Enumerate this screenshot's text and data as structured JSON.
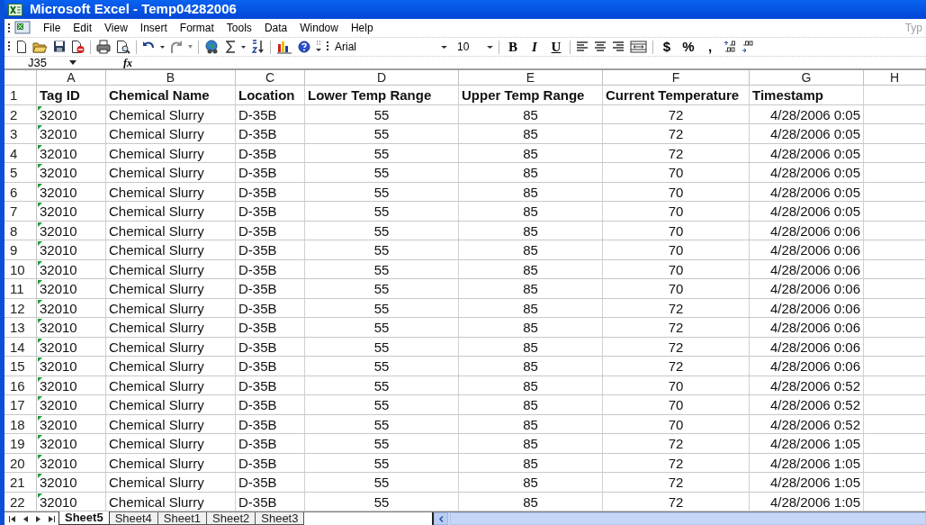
{
  "window": {
    "title": "Microsoft Excel - Temp04282006"
  },
  "menu": [
    "File",
    "Edit",
    "View",
    "Insert",
    "Format",
    "Tools",
    "Data",
    "Window",
    "Help"
  ],
  "help_box": {
    "placeholder": "Typ"
  },
  "toolbar": {
    "font": "Arial",
    "size": "10",
    "format_buttons": [
      "B",
      "I",
      "U"
    ],
    "number_buttons": [
      "$",
      "%",
      ","
    ]
  },
  "formula_bar": {
    "name_box": "J35",
    "fx": "fx"
  },
  "columns": [
    "A",
    "B",
    "C",
    "D",
    "E",
    "F",
    "G",
    "H"
  ],
  "header_row": {
    "number": "1",
    "cells": [
      "Tag ID",
      "Chemical Name",
      "Location",
      "Lower Temp Range",
      "Upper Temp Range",
      "Current Temperature",
      "Timestamp"
    ]
  },
  "rows": [
    {
      "number": "2",
      "cells": [
        "32010",
        "Chemical Slurry",
        "D-35B",
        "55",
        "85",
        "72",
        "4/28/2006 0:05"
      ]
    },
    {
      "number": "3",
      "cells": [
        "32010",
        "Chemical Slurry",
        "D-35B",
        "55",
        "85",
        "72",
        "4/28/2006 0:05"
      ]
    },
    {
      "number": "4",
      "cells": [
        "32010",
        "Chemical Slurry",
        "D-35B",
        "55",
        "85",
        "72",
        "4/28/2006 0:05"
      ]
    },
    {
      "number": "5",
      "cells": [
        "32010",
        "Chemical Slurry",
        "D-35B",
        "55",
        "85",
        "70",
        "4/28/2006 0:05"
      ]
    },
    {
      "number": "6",
      "cells": [
        "32010",
        "Chemical Slurry",
        "D-35B",
        "55",
        "85",
        "70",
        "4/28/2006 0:05"
      ]
    },
    {
      "number": "7",
      "cells": [
        "32010",
        "Chemical Slurry",
        "D-35B",
        "55",
        "85",
        "70",
        "4/28/2006 0:05"
      ]
    },
    {
      "number": "8",
      "cells": [
        "32010",
        "Chemical Slurry",
        "D-35B",
        "55",
        "85",
        "70",
        "4/28/2006 0:06"
      ]
    },
    {
      "number": "9",
      "cells": [
        "32010",
        "Chemical Slurry",
        "D-35B",
        "55",
        "85",
        "70",
        "4/28/2006 0:06"
      ]
    },
    {
      "number": "10",
      "cells": [
        "32010",
        "Chemical Slurry",
        "D-35B",
        "55",
        "85",
        "70",
        "4/28/2006 0:06"
      ]
    },
    {
      "number": "11",
      "cells": [
        "32010",
        "Chemical Slurry",
        "D-35B",
        "55",
        "85",
        "70",
        "4/28/2006 0:06"
      ]
    },
    {
      "number": "12",
      "cells": [
        "32010",
        "Chemical Slurry",
        "D-35B",
        "55",
        "85",
        "72",
        "4/28/2006 0:06"
      ]
    },
    {
      "number": "13",
      "cells": [
        "32010",
        "Chemical Slurry",
        "D-35B",
        "55",
        "85",
        "72",
        "4/28/2006 0:06"
      ]
    },
    {
      "number": "14",
      "cells": [
        "32010",
        "Chemical Slurry",
        "D-35B",
        "55",
        "85",
        "72",
        "4/28/2006 0:06"
      ]
    },
    {
      "number": "15",
      "cells": [
        "32010",
        "Chemical Slurry",
        "D-35B",
        "55",
        "85",
        "72",
        "4/28/2006 0:06"
      ]
    },
    {
      "number": "16",
      "cells": [
        "32010",
        "Chemical Slurry",
        "D-35B",
        "55",
        "85",
        "70",
        "4/28/2006 0:52"
      ]
    },
    {
      "number": "17",
      "cells": [
        "32010",
        "Chemical Slurry",
        "D-35B",
        "55",
        "85",
        "70",
        "4/28/2006 0:52"
      ]
    },
    {
      "number": "18",
      "cells": [
        "32010",
        "Chemical Slurry",
        "D-35B",
        "55",
        "85",
        "70",
        "4/28/2006 0:52"
      ]
    },
    {
      "number": "19",
      "cells": [
        "32010",
        "Chemical Slurry",
        "D-35B",
        "55",
        "85",
        "72",
        "4/28/2006 1:05"
      ]
    },
    {
      "number": "20",
      "cells": [
        "32010",
        "Chemical Slurry",
        "D-35B",
        "55",
        "85",
        "72",
        "4/28/2006 1:05"
      ]
    },
    {
      "number": "21",
      "cells": [
        "32010",
        "Chemical Slurry",
        "D-35B",
        "55",
        "85",
        "72",
        "4/28/2006 1:05"
      ]
    },
    {
      "number": "22",
      "cells": [
        "32010",
        "Chemical Slurry",
        "D-35B",
        "55",
        "85",
        "72",
        "4/28/2006 1:05"
      ]
    }
  ],
  "sheet_tabs": [
    {
      "label": "Sheet5",
      "selected": true
    },
    {
      "label": "Sheet4",
      "selected": false
    },
    {
      "label": "Sheet1",
      "selected": false
    },
    {
      "label": "Sheet2",
      "selected": false
    },
    {
      "label": "Sheet3",
      "selected": false
    }
  ]
}
